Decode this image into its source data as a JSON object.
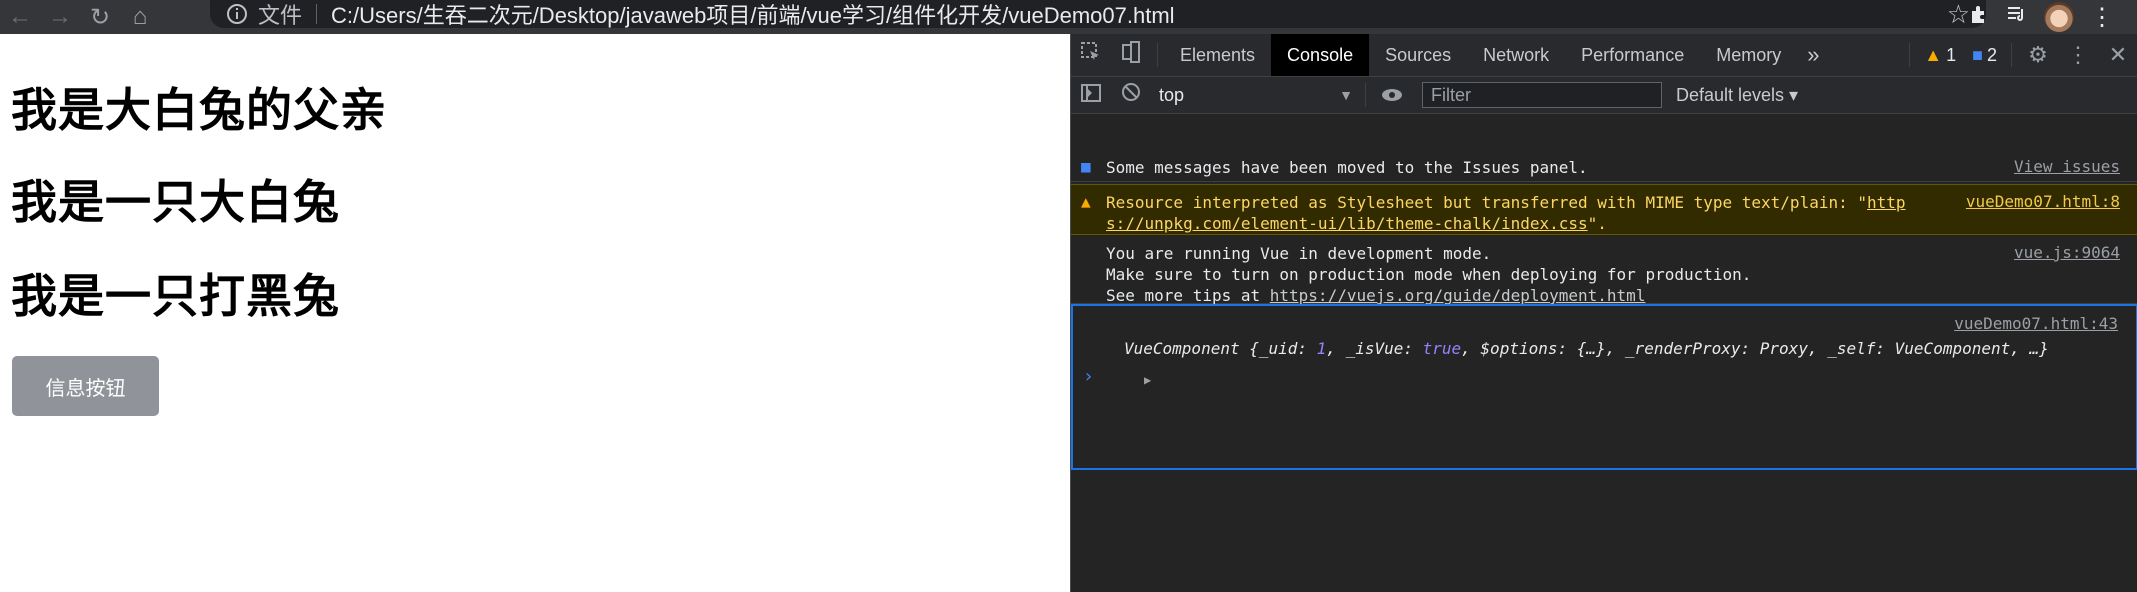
{
  "browser": {
    "scheme_label": "文件",
    "url": "C:/Users/生吞二次元/Desktop/javaweb项目/前端/vue学习/组件化开发/vueDemo07.html"
  },
  "page": {
    "headings": [
      "我是大白兔的父亲",
      "我是一只大白兔",
      "我是一只打黑兔"
    ],
    "button_label": "信息按钮"
  },
  "devtools": {
    "tabs": [
      "Elements",
      "Console",
      "Sources",
      "Network",
      "Performance",
      "Memory"
    ],
    "active_tab": "Console",
    "more_tabs": "»",
    "warnings_count": "1",
    "issues_count": "2",
    "context": "top",
    "filter_placeholder": "Filter",
    "levels": "Default levels ▾",
    "messages": {
      "issues": {
        "text": "Some messages have been moved to the Issues panel.",
        "link": "View issues"
      },
      "warning": {
        "line1_prefix": "Resource interpreted as Stylesheet but transferred with MIME type text/plain: \"",
        "line1_link": "http",
        "line2_link": "s://unpkg.com/element-ui/lib/theme-chalk/index.css",
        "line2_suffix": "\".",
        "source": "vueDemo07.html:8"
      },
      "vue": {
        "line1": "You are running Vue in development mode.",
        "line2": "Make sure to turn on production mode when deploying for production.",
        "line3_prefix": "See more tips at ",
        "line3_link": "https://vuejs.org/guide/deployment.html",
        "source": "vue.js:9064"
      },
      "object": {
        "source": "vueDemo07.html:43",
        "name": "VueComponent",
        "uid_key": "_uid",
        "uid_val": "1",
        "isvue_key": "_isVue",
        "isvue_val": "true",
        "options_key": "$options",
        "options_val": "{…}",
        "renderproxy_key": "_renderProxy",
        "renderproxy_val": "Proxy",
        "self_key": "_self",
        "self_val": "VueComponent"
      }
    }
  }
}
